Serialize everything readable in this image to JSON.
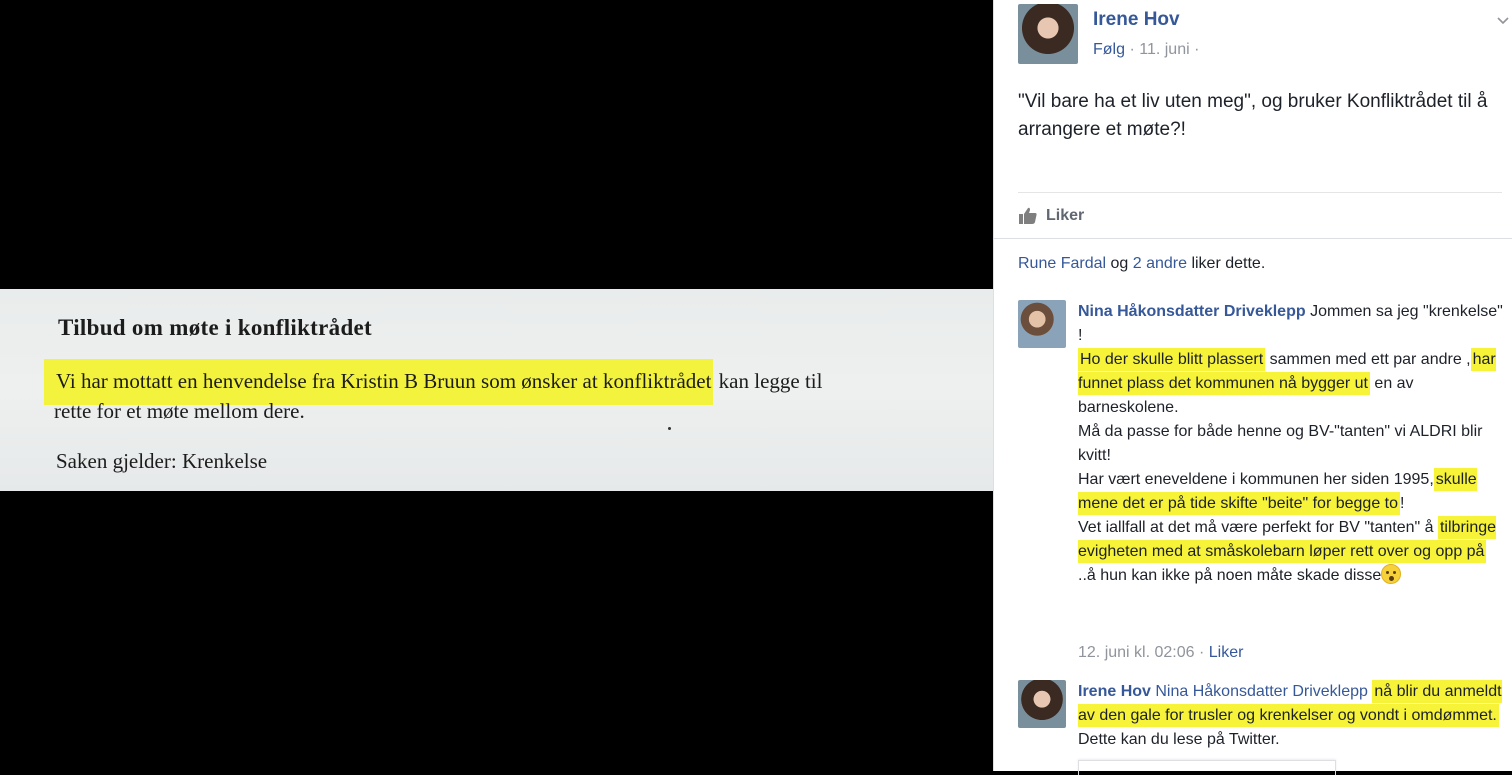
{
  "viewer": {
    "doc": {
      "title": "Tilbud om møte i konfliktrådet",
      "line1_highlighted": "Vi har mottatt en henvendelse fra Kristin B Bruun  som ønsker at konfliktrådet",
      "line1_rest": " kan legge til",
      "line2": "rette for et møte mellom dere.",
      "line3": "Saken gjelder: Krenkelse"
    }
  },
  "post": {
    "author": "Irene Hov",
    "follow_label": "Følg",
    "date": "11. juni",
    "text": "\"Vil bare ha et liv uten meg\", og bruker Konfliktrådet til å arrangere et møte?!",
    "like_label": "Liker",
    "likes_summary": {
      "first_name": "Rune Fardal",
      "conj": " og ",
      "others": "2 andre",
      "suffix": " liker dette."
    }
  },
  "comments": [
    {
      "author": "Nina Håkonsdatter Driveklepp",
      "t1": " Jommen sa jeg \"krenkelse\" !",
      "h1": "Ho der skulle blitt plassert",
      "t2": " sammen med ett par andre ,",
      "h2": "har funnet plass det kommunen nå bygger ut",
      "t3": " en av barneskolene.",
      "t4": "Må da passe for både henne og BV-\"tanten\" vi ALDRI blir kvitt!",
      "t5": "Har vært eneveldene i kommunen her siden 1995,",
      "h3": "skulle mene det er på tide skifte \"beite\" for begge to",
      "t6": "!",
      "t7": "Vet iallfall at det må være perfekt for BV \"tanten\" å ",
      "h4": "tilbringe evigheten med at småskolebarn løper rett over og opp på",
      "t8": " ..å hun kan ikke på noen måte skade disse",
      "timestamp": "12. juni kl. 02:06",
      "sep": " · ",
      "like_label": "Liker"
    },
    {
      "author": "Irene Hov",
      "mention": "Nina Håkonsdatter Driveklepp",
      "h1": "nå blir du anmeldt av den gale for trusler og krenkelser og vondt i omdømmet.",
      "t1": " Dette kan du lese på Twitter."
    }
  ],
  "colors": {
    "link": "#365899",
    "highlight": "#f6f339",
    "meta": "#90949c"
  },
  "icons": [
    "chevron-down-icon",
    "thumbs-up-icon",
    "smiley-emoji-icon"
  ]
}
